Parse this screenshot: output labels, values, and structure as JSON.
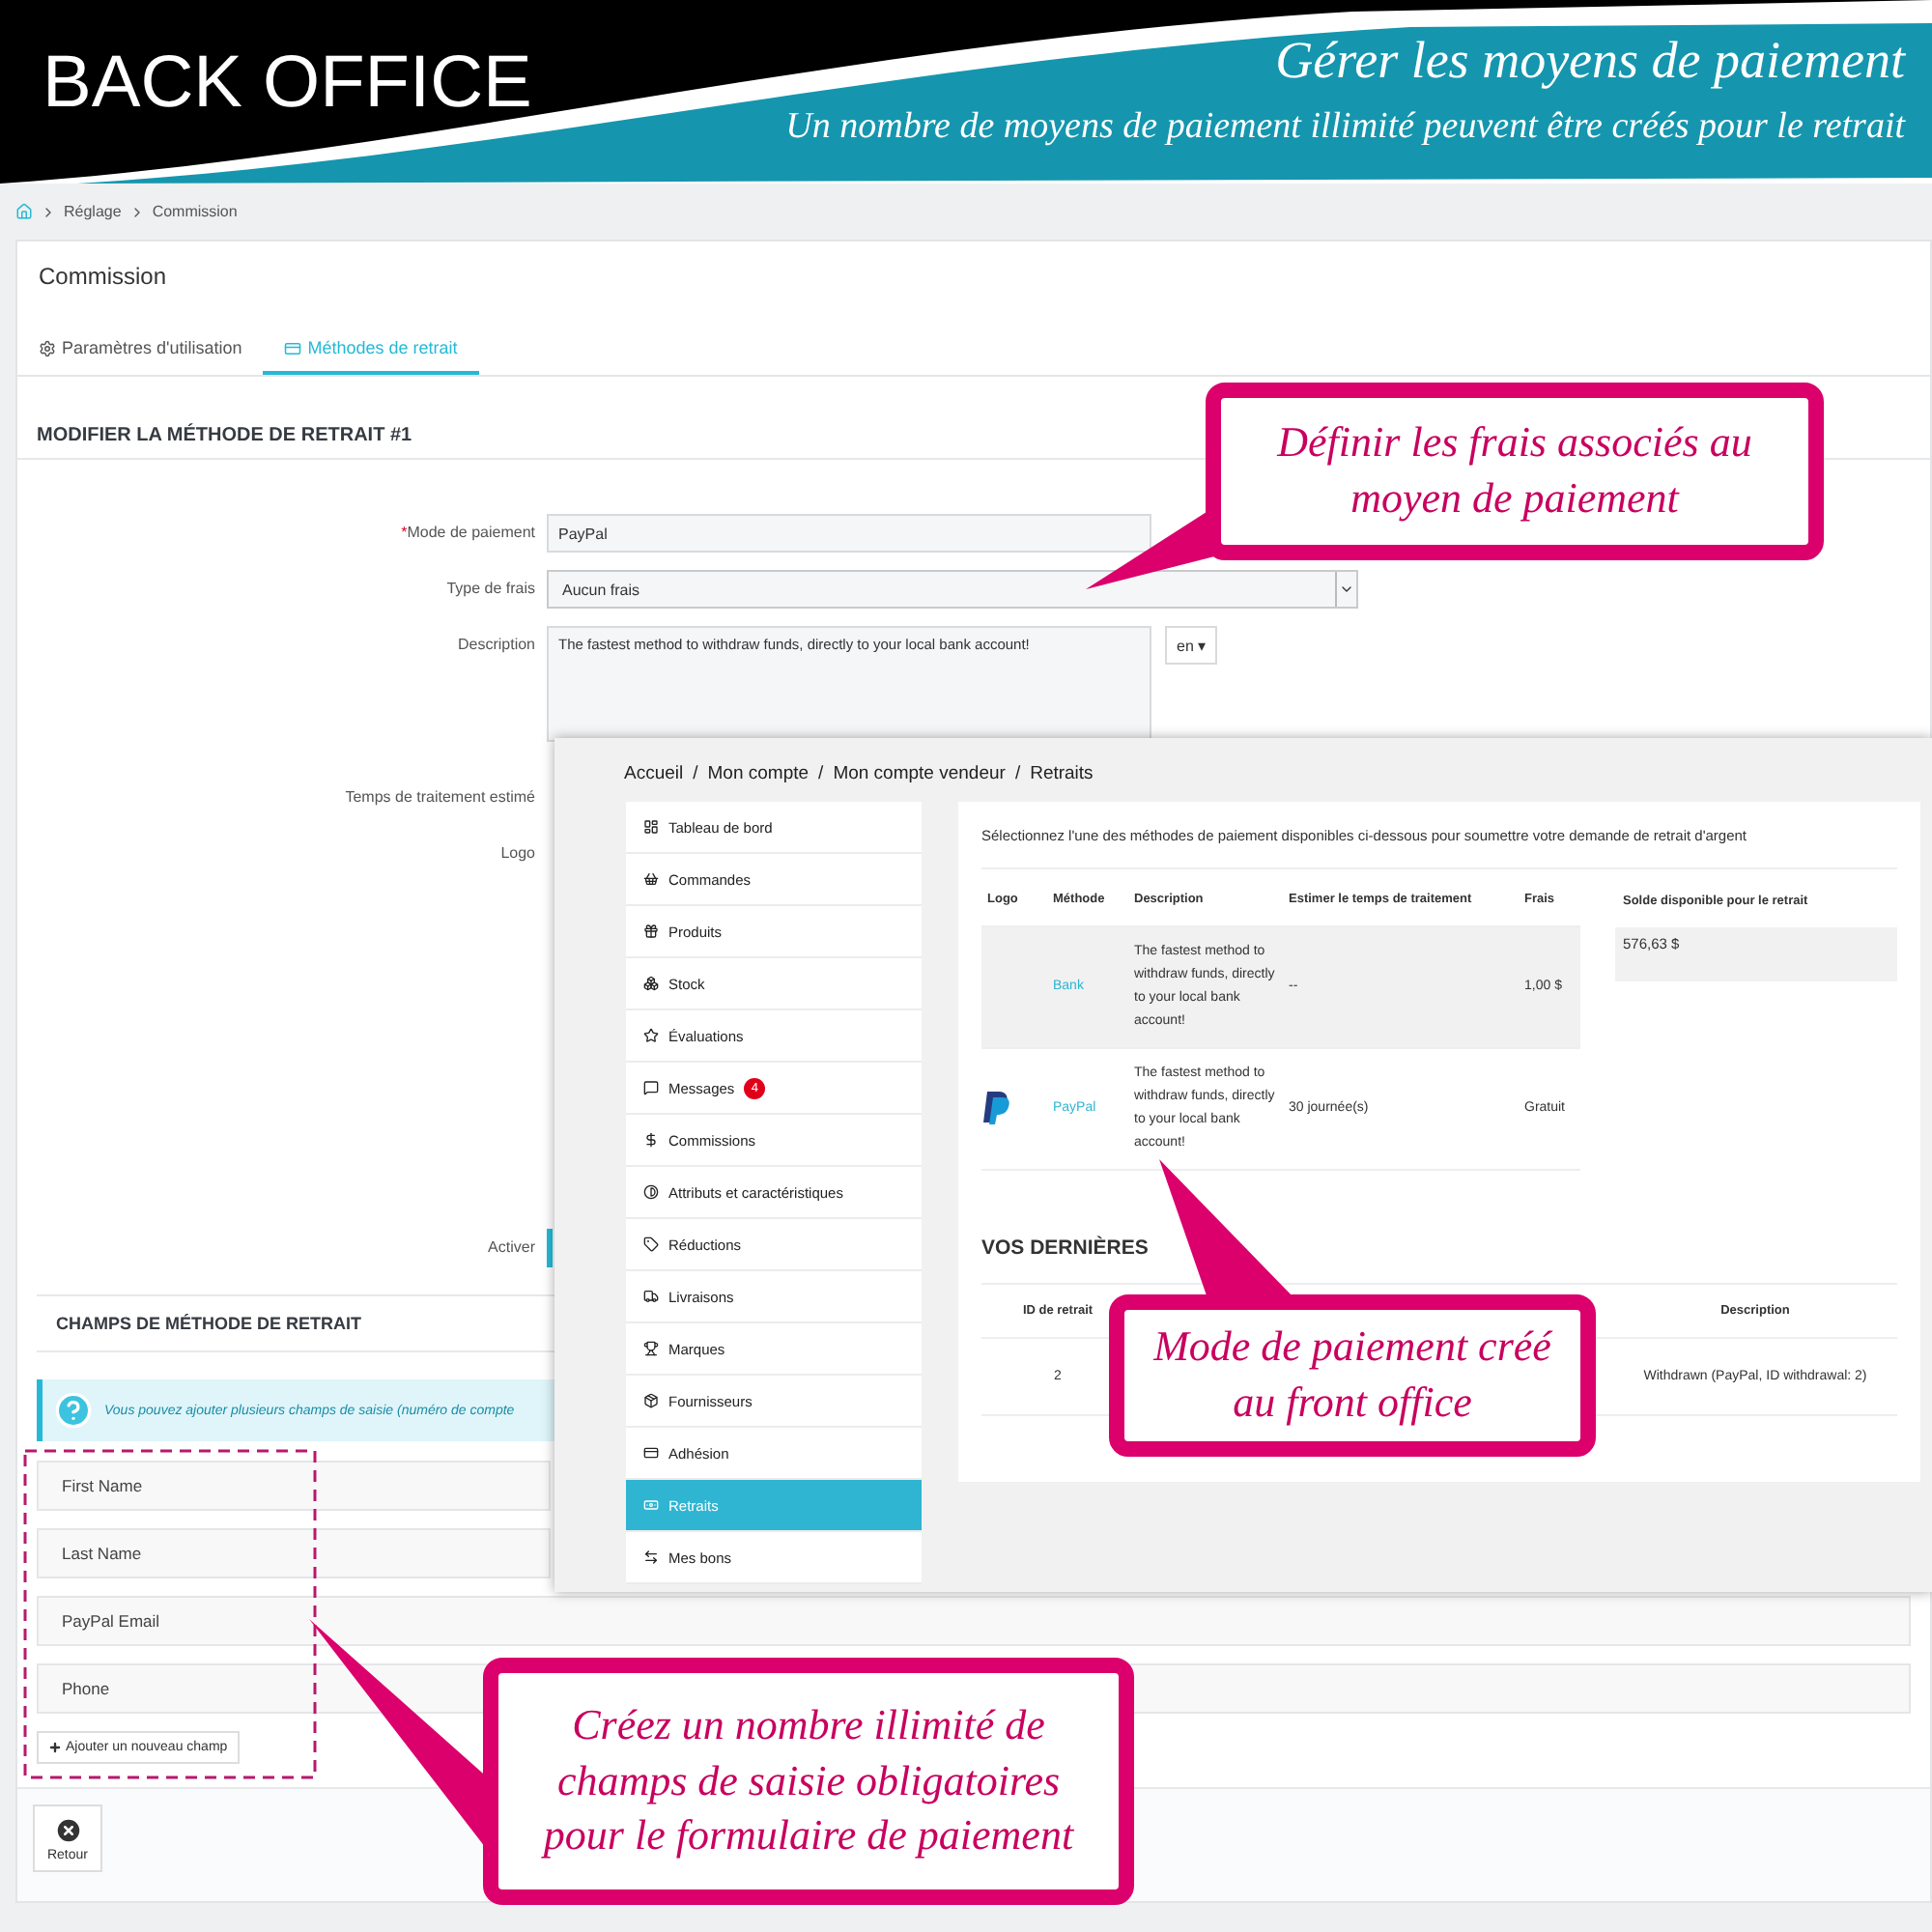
{
  "banner": {
    "title": "BACK OFFICE",
    "heading": "Gérer les moyens de paiement",
    "subheading": "Un nombre de moyens de paiement illimité peuvent être créés pour le retrait"
  },
  "breadcrumb": [
    "Réglage",
    "Commission"
  ],
  "page_title": "Commission",
  "tabs": [
    {
      "label": "Paramètres d'utilisation",
      "selected": false
    },
    {
      "label": "Méthodes de retrait",
      "selected": true
    }
  ],
  "edit_section": {
    "title": "MODIFIER LA MÉTHODE DE RETRAIT #1",
    "fields": [
      {
        "label": "Mode de paiement",
        "required_mark": "*",
        "kind": "text",
        "value": "PayPal"
      },
      {
        "label": "Type de frais",
        "kind": "select",
        "value": "Aucun frais"
      },
      {
        "label": "Description",
        "kind": "textarea",
        "value": "The fastest method to withdraw funds, directly to your local bank account!",
        "language": "en ▾"
      },
      {
        "label": "Temps de traitement estimé",
        "kind": "label"
      },
      {
        "label": "Logo",
        "kind": "label"
      },
      {
        "label": "Activer",
        "kind": "switch",
        "on": true
      }
    ]
  },
  "fields_section": {
    "title": "CHAMPS DE MÉTHODE DE RETRAIT",
    "info": "Vous pouvez ajouter plusieurs champs de saisie (numéro de compte",
    "fields": [
      "First Name",
      "Last Name",
      "PayPal Email",
      "Phone"
    ],
    "add_button": "Ajouter un nouveau champ"
  },
  "back_button": "Retour",
  "front_office": {
    "breadcrumb": {
      "separator": "/",
      "items": [
        "Accueil",
        "Mon compte",
        "Mon compte vendeur",
        "Retraits"
      ]
    },
    "menu": [
      {
        "label": "Tableau de bord",
        "selected": false
      },
      {
        "label": "Commandes",
        "selected": false
      },
      {
        "label": "Produits",
        "selected": false
      },
      {
        "label": "Stock",
        "selected": false
      },
      {
        "label": "Évaluations",
        "selected": false
      },
      {
        "label": "Messages",
        "selected": false,
        "badge": "4"
      },
      {
        "label": "Commissions",
        "selected": false
      },
      {
        "label": "Attributs et caractéristiques",
        "selected": false
      },
      {
        "label": "Réductions",
        "selected": false
      },
      {
        "label": "Livraisons",
        "selected": false
      },
      {
        "label": "Marques",
        "selected": false
      },
      {
        "label": "Fournisseurs",
        "selected": false
      },
      {
        "label": "Adhésion",
        "selected": false
      },
      {
        "label": "Retraits",
        "selected": true
      },
      {
        "label": "Mes bons",
        "selected": false
      }
    ],
    "intro": "Sélectionnez l'une des méthodes de paiement disponibles ci-dessous pour soumettre votre demande de retrait d'argent",
    "methods": {
      "columns": [
        "Logo",
        "Méthode",
        "Description",
        "Estimer le temps de traitement",
        "Frais"
      ],
      "rows": [
        {
          "has_logo": false,
          "highlighted": true,
          "method": "Bank",
          "description": "The fastest method to withdraw funds, directly to your local bank account!",
          "time": "--",
          "fee": "1,00 $"
        },
        {
          "has_logo": true,
          "highlighted": false,
          "method": "PayPal",
          "description": "The fastest method to withdraw funds, directly to your local bank account!",
          "time": "30 journée(s)",
          "fee": "Gratuit"
        }
      ]
    },
    "balance": {
      "label": "Solde disponible pour le retrait",
      "value": "576,63 $"
    },
    "recent": {
      "title": "VOS DERNIÈRES",
      "columns": [
        "ID de retrait",
        "Description"
      ],
      "rows": [
        [
          "2",
          "Withdrawn (PayPal, ID withdrawal: 2)"
        ]
      ]
    }
  },
  "callouts": [
    {
      "text": "Définir les frais associés au moyen de paiement"
    },
    {
      "text": "Mode de paiement créé au front office"
    },
    {
      "text": "Créez un nombre illimité de champs de saisie obligatoires pour le formulaire de paiement"
    }
  ]
}
